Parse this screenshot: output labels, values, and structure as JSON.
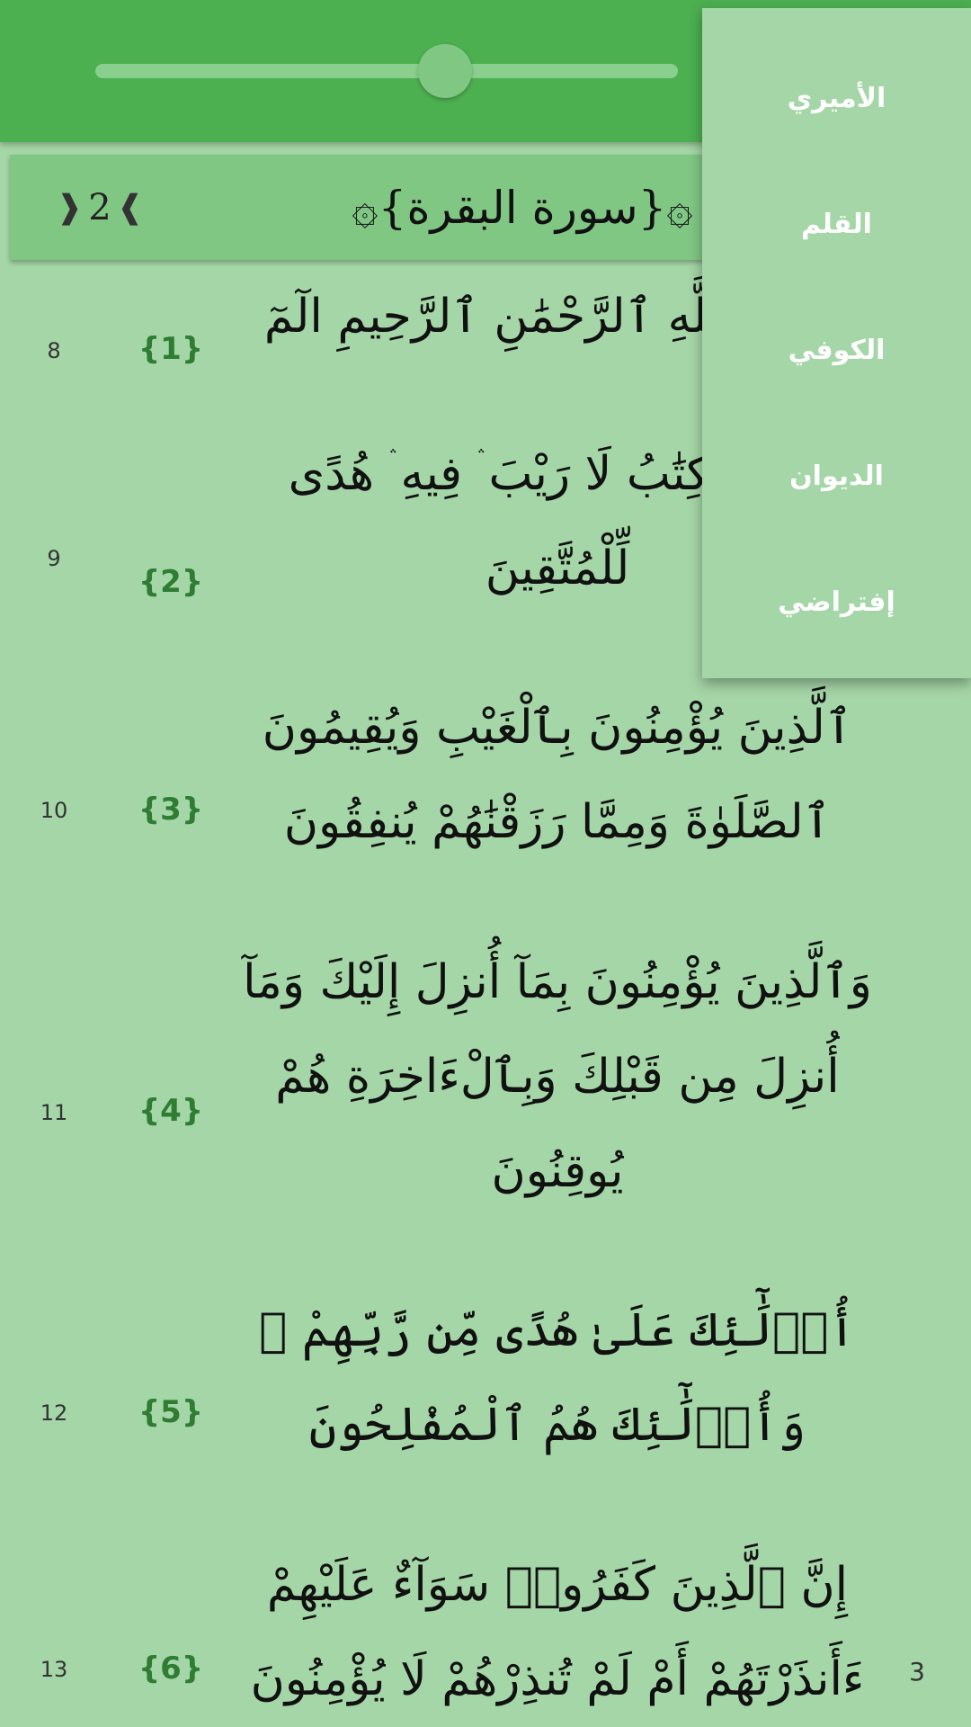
{
  "toolbar": {
    "slider_value_percent": 60
  },
  "header": {
    "surah_title": "۞{سورة البقرة}۞",
    "juz_number": "2"
  },
  "verses": [
    {
      "text": "بِسْمِ ٱللَّهِ ٱلرَّحْمَٰنِ ٱلرَّحِيمِ الٓمٓ",
      "marker": "{1}",
      "line": "8"
    },
    {
      "text": "ذَٰلِكَ ٱلْكِتَٰبُ لَا رَيْبَ ۛ فِيهِ ۛ هُدًى لِّلْمُتَّقِينَ",
      "marker": "{2}",
      "line": "9"
    },
    {
      "text": "ٱلَّذِينَ يُؤْمِنُونَ بِٱلْغَيْبِ وَيُقِيمُونَ ٱلصَّلَوٰةَ وَمِمَّا رَزَقْنَٰهُمْ يُنفِقُونَ",
      "marker": "{3}",
      "line": "10"
    },
    {
      "text": "وَٱلَّذِينَ يُؤْمِنُونَ بِمَآ أُنزِلَ إِلَيْكَ وَمَآ أُنزِلَ مِن قَبْلِكَ وَبِٱلْءَاخِرَةِ هُمْ يُوقِنُونَ",
      "marker": "{4}",
      "line": "11"
    },
    {
      "text": "أُو۟لَٰٓئِكَ عَلَىٰ هُدًى مِّن رَّبِّهِمْ ۖ وَأُو۟لَٰٓئِكَ هُمُ ٱلْمُفْلِحُونَ",
      "marker": "{5}",
      "line": "12"
    },
    {
      "text": "إِنَّ ٱلَّذِينَ كَفَرُوا۟ سَوَآءٌ عَلَيْهِمْ ءَأَنذَرْتَهُمْ أَمْ لَمْ تُنذِرْهُمْ لَا يُؤْمِنُونَ",
      "marker": "{6}",
      "line": "13"
    }
  ],
  "page_number": "3",
  "font_menu": {
    "items": [
      "الأميري",
      "القلم",
      "الكوفي",
      "الديوان",
      "إفتراضي"
    ]
  },
  "colors": {
    "toolbar": "#4caf50",
    "background": "#a5d6a7",
    "header": "#81c784",
    "verse_marker": "#2e7d32"
  }
}
